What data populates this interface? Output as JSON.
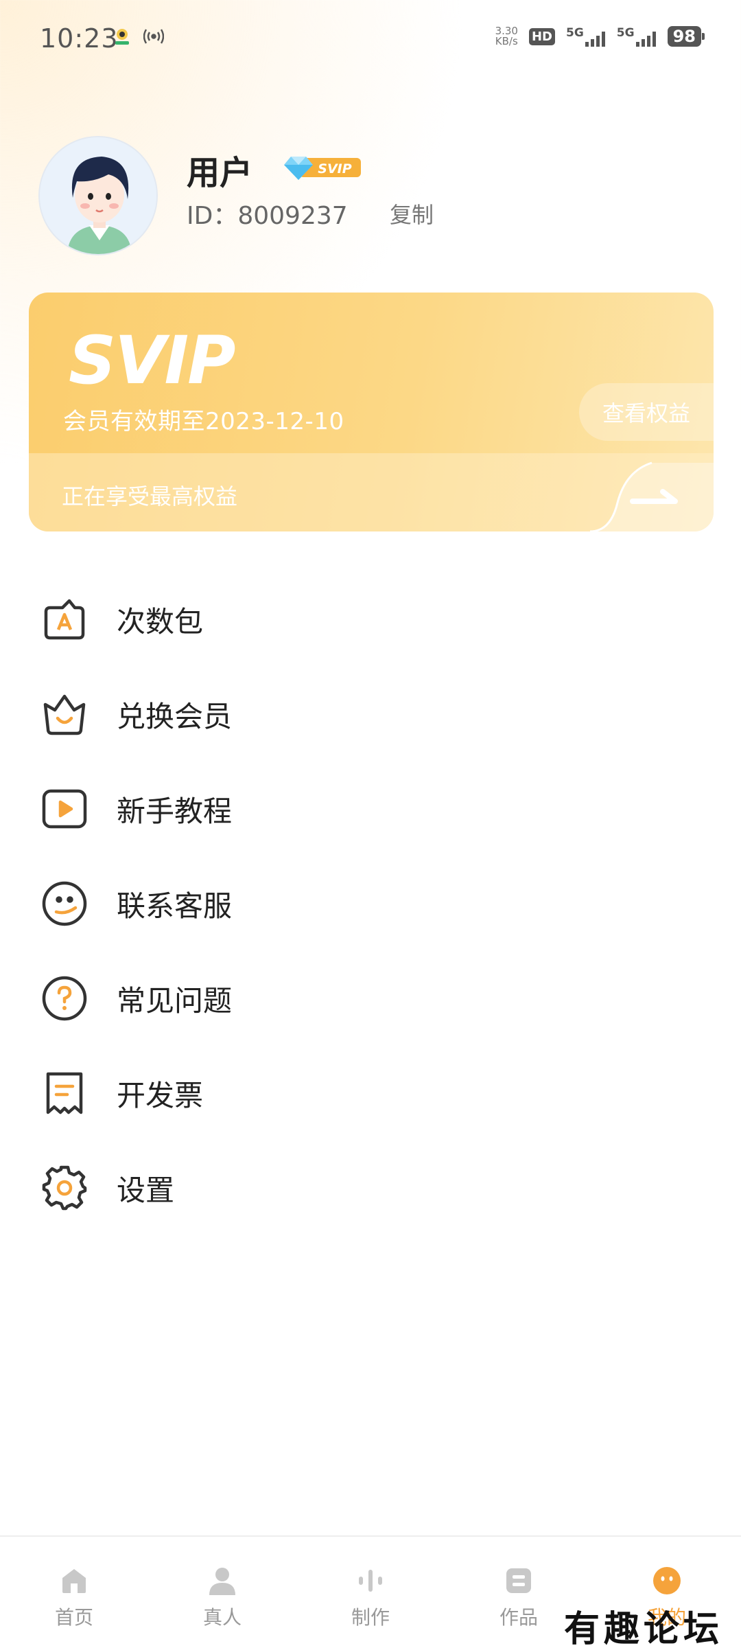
{
  "status_bar": {
    "time": "10:23",
    "net_speed_value": "3.30",
    "net_speed_unit": "KB/s",
    "hd_label": "HD",
    "network_1": "5G",
    "network_2": "5G",
    "battery": "98"
  },
  "profile": {
    "name": "用户",
    "badge": "SVIP",
    "id_text": "ID：8009237",
    "copy_label": "复制"
  },
  "svip_card": {
    "logo": "SVIP",
    "expiry": "会员有效期至2023-12-10",
    "view_benefits": "查看权益",
    "status": "正在享受最高权益"
  },
  "menu": {
    "items": [
      {
        "label": "次数包",
        "icon": "count-pack-icon"
      },
      {
        "label": "兑换会员",
        "icon": "crown-icon"
      },
      {
        "label": "新手教程",
        "icon": "play-icon"
      },
      {
        "label": "联系客服",
        "icon": "customer-service-icon"
      },
      {
        "label": "常见问题",
        "icon": "question-icon"
      },
      {
        "label": "开发票",
        "icon": "invoice-icon"
      },
      {
        "label": "设置",
        "icon": "gear-icon"
      }
    ]
  },
  "bottom_nav": {
    "items": [
      {
        "label": "首页",
        "icon": "home-icon"
      },
      {
        "label": "真人",
        "icon": "person-icon"
      },
      {
        "label": "制作",
        "icon": "audio-bars-icon"
      },
      {
        "label": "作品",
        "icon": "works-icon"
      },
      {
        "label": "我的",
        "icon": "mine-icon"
      }
    ]
  },
  "watermark": "有趣论坛",
  "colors": {
    "accent": "#f5a33b",
    "card": "#fbcd6d",
    "text": "#222222"
  }
}
